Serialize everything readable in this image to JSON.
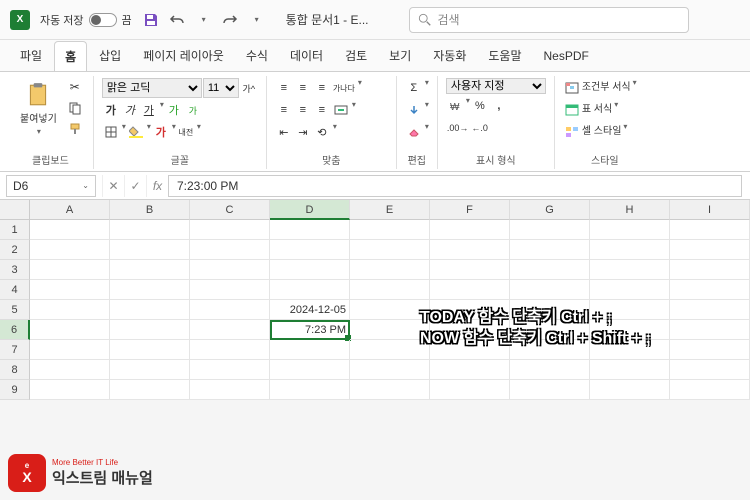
{
  "titlebar": {
    "autosave_label": "자동 저장",
    "autosave_state": "끔",
    "doc_title": "통합 문서1 - E...",
    "search_placeholder": "검색"
  },
  "tabs": [
    "파일",
    "홈",
    "삽입",
    "페이지 레이아웃",
    "수식",
    "데이터",
    "검토",
    "보기",
    "자동화",
    "도움말",
    "NesPDF"
  ],
  "ribbon": {
    "clipboard": {
      "paste": "붙여넣기",
      "label": "클립보드"
    },
    "font": {
      "name": "맑은 고딕",
      "size": "11",
      "label": "글꼴",
      "bold": "가",
      "italic": "가",
      "underline": "가",
      "ruby": "내전"
    },
    "align": {
      "label": "맞춤",
      "wrap": "가나다"
    },
    "edit": {
      "label": "편집"
    },
    "number": {
      "format": "사용자 지정",
      "label": "표시 형식",
      "currency": "%",
      "comma": ","
    },
    "styles": {
      "cond": "조건부 서식",
      "table": "표 서식",
      "cell": "셀 스타일",
      "label": "스타일"
    }
  },
  "namebox": "D6",
  "formula": "7:23:00 PM",
  "columns": [
    "A",
    "B",
    "C",
    "D",
    "E",
    "F",
    "G",
    "H",
    "I"
  ],
  "rows": [
    "1",
    "2",
    "3",
    "4",
    "5",
    "6",
    "7",
    "8",
    "9"
  ],
  "cells": {
    "D5": "2024-12-05",
    "D6": "7:23 PM"
  },
  "overlay": {
    "line1": "TODAY 함수 단축키 Ctrl + ;",
    "line2": "NOW 함수 단축키 Ctrl + Shift + ;"
  },
  "watermark": {
    "brand": "익스트림 매뉴얼",
    "tag": "More Better IT Life"
  }
}
